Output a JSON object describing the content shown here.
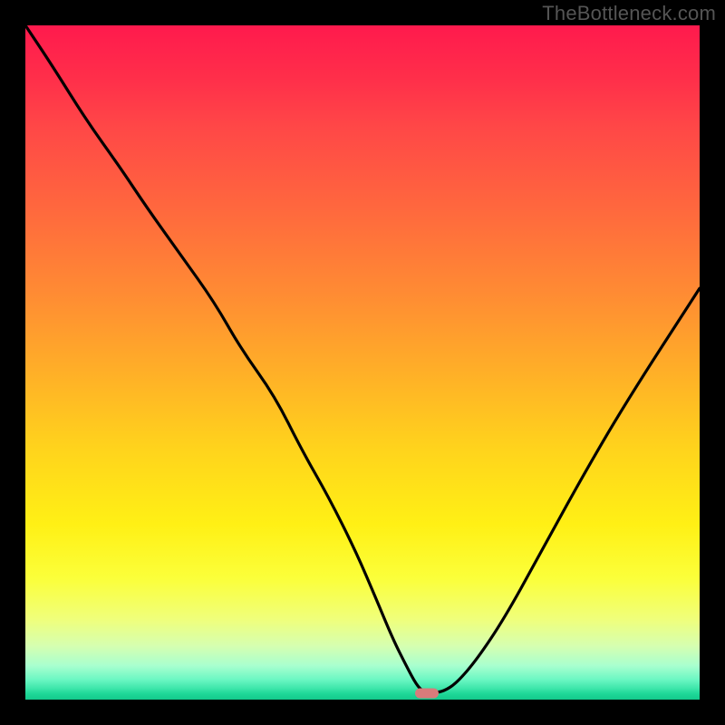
{
  "watermark": "TheBottleneck.com",
  "chart_data": {
    "type": "line",
    "title": "",
    "xlabel": "",
    "ylabel": "",
    "xlim": [
      0,
      100
    ],
    "ylim": [
      0,
      100
    ],
    "grid": false,
    "series": [
      {
        "name": "bottleneck-curve",
        "x": [
          0,
          4,
          9,
          14,
          18,
          23,
          28,
          32,
          37,
          41,
          45,
          49,
          52,
          54.5,
          56.5,
          58,
          59,
          60.3,
          62,
          64,
          67,
          71,
          76,
          82,
          89,
          100
        ],
        "y": [
          100,
          94,
          86,
          79,
          73,
          66,
          59,
          52,
          45,
          37,
          30,
          22,
          15,
          9,
          5,
          2.2,
          1.2,
          1.0,
          1.2,
          2.5,
          6,
          12,
          21,
          32,
          44,
          61
        ]
      }
    ],
    "annotations": [
      {
        "name": "minimum-marker",
        "x": 59.5,
        "y": 1.0
      }
    ],
    "background_gradient": {
      "top_color": "#ff1a4d",
      "bottom_color": "#13c98c"
    }
  }
}
